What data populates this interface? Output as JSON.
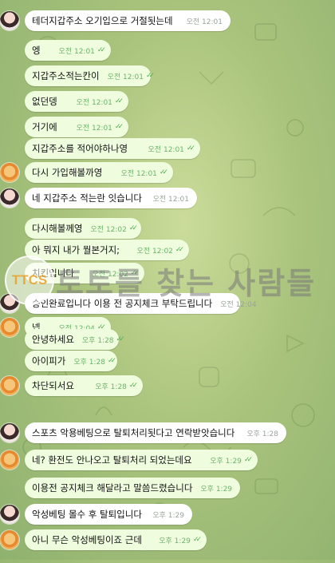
{
  "messages": [
    {
      "side": "in",
      "avatar": "user-avatar",
      "text": "테더지갑주소 오기입으로 거절됫는데",
      "time": "오전 12:01",
      "read": false
    },
    {
      "side": "out",
      "avatar": "",
      "text": "엥",
      "time": "오전 12:01",
      "read": true
    },
    {
      "side": "out",
      "avatar": "",
      "text": "지갑주소적는칸이",
      "time": "오전 12:01",
      "read": true
    },
    {
      "side": "out",
      "avatar": "",
      "text": "없던뎅",
      "time": "오전 12:01",
      "read": true
    },
    {
      "side": "out",
      "avatar": "",
      "text": "거기에",
      "time": "오전 12:01",
      "read": true
    },
    {
      "side": "out",
      "avatar": "",
      "text": "지갑주소를 적어야하나영",
      "time": "오전 12:01",
      "read": true
    },
    {
      "side": "out",
      "avatar": "toast-avatar",
      "text": "다시 가입해볼까영",
      "time": "오전 12:01",
      "read": true
    },
    {
      "side": "in",
      "avatar": "user-avatar",
      "text": "네 지갑주소 적는란 잇습니다",
      "time": "오전 12:01",
      "read": false
    },
    {
      "side": "out",
      "avatar": "",
      "text": "다시해볼께영",
      "time": "오전 12:02",
      "read": true
    },
    {
      "side": "out",
      "avatar": "",
      "text": "아 뭐지 내가 뭘본거지;",
      "time": "오전 12:02",
      "read": true
    },
    {
      "side": "out",
      "avatar": "",
      "text": "치킨입니다",
      "time": "오전 12:02",
      "read": true
    },
    {
      "side": "in",
      "avatar": "user-avatar",
      "text": "승인완료입니다 이용 전 공지체크 부탁드립니다",
      "time": "오전 12:04",
      "read": false
    },
    {
      "side": "out",
      "avatar": "toast-avatar",
      "text": "넵",
      "time": "오전 12:04",
      "read": true
    },
    {
      "side": "out",
      "avatar": "",
      "text": "안녕하세요",
      "time": "오후 1:28",
      "read": true
    },
    {
      "side": "out",
      "avatar": "",
      "text": "아이피가",
      "time": "오후 1:28",
      "read": true
    },
    {
      "side": "out",
      "avatar": "toast-avatar",
      "text": "차단되서요",
      "time": "오후 1:28",
      "read": true
    },
    {
      "side": "in",
      "avatar": "user-avatar",
      "text": "스포츠 악용베팅으로 탈퇴처리됫다고 연락받앗습니다",
      "time": "오후 1:28",
      "read": false
    },
    {
      "side": "out",
      "avatar": "toast-avatar",
      "text": "네? 환전도 안나오고 탈퇴처리 되었는데요",
      "time": "오후 1:29",
      "read": true
    },
    {
      "side": "out",
      "avatar": "",
      "text": "이용전 공지체크 해달라고 말씀드렸습니다",
      "time": "오후 1:29",
      "read": false
    },
    {
      "side": "in",
      "avatar": "user-avatar",
      "text": "악성베팅 몰수 후 탈퇴입니다",
      "time": "오후 1:29",
      "read": false
    },
    {
      "side": "out",
      "avatar": "toast-avatar",
      "text": "아니 무슨 악성베팅이죠 근데",
      "time": "오후 1:29",
      "read": true
    }
  ],
  "watermark": {
    "logo": "TTCS",
    "text": "토토를 찾는 사람들"
  },
  "colors": {
    "incoming": "#ffffff",
    "outgoing": "#effdde",
    "check": "#4fae4e",
    "background": "#a9c37c"
  }
}
